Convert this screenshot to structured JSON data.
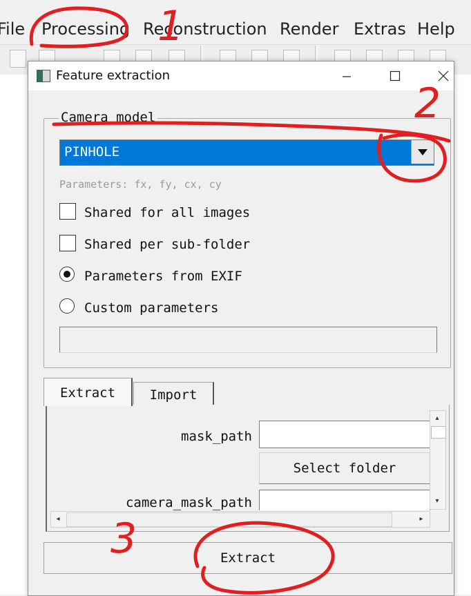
{
  "menubar": {
    "items": [
      "File",
      "Processing",
      "Reconstruction",
      "Render",
      "Extras",
      "Help"
    ]
  },
  "dialog": {
    "title": "Feature extraction",
    "window_controls": [
      "minimize-icon",
      "maximize-icon",
      "close-icon"
    ],
    "camera_model": {
      "group_title": "Camera model",
      "selected": "PINHOLE",
      "params_hint": "Parameters: fx, fy, cx, cy",
      "options": [
        {
          "type": "checkbox",
          "label": "Shared for all images",
          "checked": false
        },
        {
          "type": "checkbox",
          "label": "Shared per sub-folder",
          "checked": false
        },
        {
          "type": "radio",
          "label": "Parameters from EXIF",
          "checked": true
        },
        {
          "type": "radio",
          "label": "Custom parameters",
          "checked": false
        }
      ],
      "custom_params_value": ""
    },
    "tabs": [
      {
        "label": "Extract",
        "active": true
      },
      {
        "label": "Import",
        "active": false
      }
    ],
    "extract_panel": {
      "mask_path_label": "mask_path",
      "mask_path_value": "",
      "select_folder_label": "Select folder",
      "camera_mask_path_label": "camera_mask_path",
      "camera_mask_path_value": ""
    },
    "extract_button": "Extract"
  },
  "annotations": {
    "color": "#e02020",
    "labels": [
      "1",
      "2",
      "3"
    ]
  }
}
